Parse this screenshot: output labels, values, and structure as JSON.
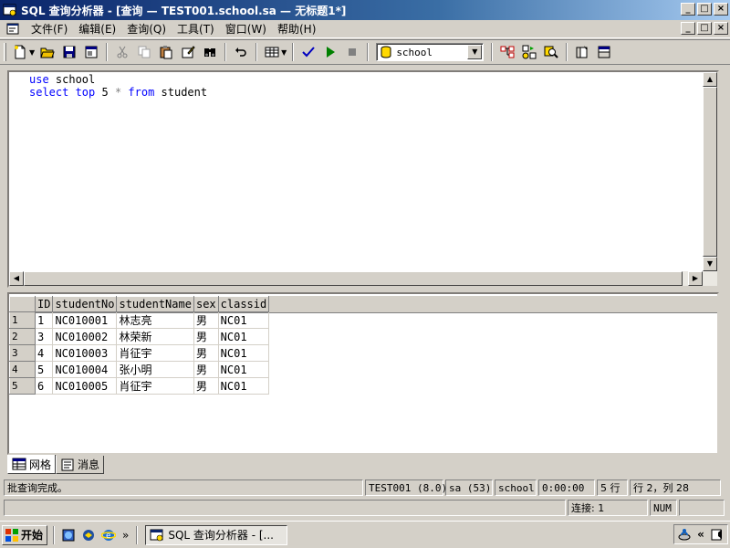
{
  "window": {
    "title": "SQL 查询分析器 - [查询 — TEST001.school.sa — 无标题1*]",
    "buttons": {
      "minimize": "_",
      "maximize": "□",
      "close": "×"
    }
  },
  "menu": {
    "items": [
      "文件(F)",
      "编辑(E)",
      "查询(Q)",
      "工具(T)",
      "窗口(W)",
      "帮助(H)"
    ]
  },
  "toolbar": {
    "database": "school"
  },
  "editor": {
    "lines": [
      {
        "kw": "use",
        "rest": " school"
      },
      {
        "kw": "select top",
        "mid": " 5 ",
        "op": "*",
        "kw2": " from",
        "rest": " student"
      }
    ]
  },
  "results": {
    "columns": [
      "ID",
      "studentNo",
      "studentName",
      "sex",
      "classid"
    ],
    "rows": [
      {
        "num": "1",
        "cells": [
          "1",
          "NC010001",
          "林志亮",
          "男",
          "NC01"
        ]
      },
      {
        "num": "2",
        "cells": [
          "3",
          "NC010002",
          "林荣新",
          "男",
          "NC01"
        ]
      },
      {
        "num": "3",
        "cells": [
          "4",
          "NC010003",
          "肖征宇",
          "男",
          "NC01"
        ]
      },
      {
        "num": "4",
        "cells": [
          "5",
          "NC010004",
          "张小明",
          "男",
          "NC01"
        ]
      },
      {
        "num": "5",
        "cells": [
          "6",
          "NC010005",
          "肖征宇",
          "男",
          "NC01"
        ]
      }
    ]
  },
  "tabs": {
    "grid": "网格",
    "messages": "消息"
  },
  "status": {
    "message": "批查询完成。",
    "server": "TEST001 (8.0)",
    "user": "sa (53)",
    "database": "school",
    "elapsed": "0:00:00",
    "rows": "5 行",
    "position": "行 2，列 28",
    "connections": "连接: 1",
    "num": "NUM"
  },
  "taskbar": {
    "start": "开始",
    "more": "»",
    "task": "SQL 查询分析器 - [...",
    "tray_more": "«"
  }
}
